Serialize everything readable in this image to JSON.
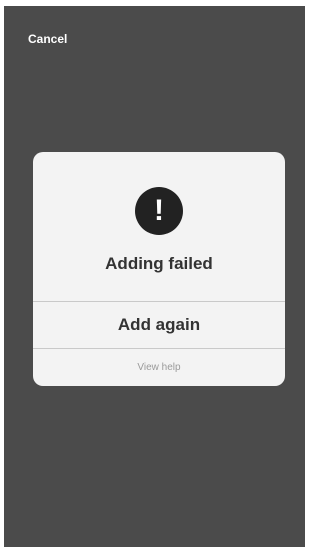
{
  "header": {
    "cancel_label": "Cancel"
  },
  "dialog": {
    "icon": "exclamation-icon",
    "icon_glyph": "!",
    "title": "Adding failed",
    "primary_action": "Add again",
    "secondary_action": "View help"
  },
  "colors": {
    "backdrop": "#4b4b4b",
    "dialog_background": "#f3f3f3",
    "icon_background": "#222222",
    "primary_text": "#333333",
    "secondary_text": "#9a9a9a",
    "divider": "#c9c9c9"
  }
}
